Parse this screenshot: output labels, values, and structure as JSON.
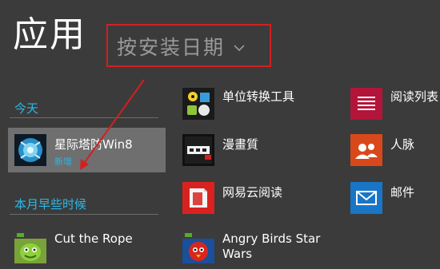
{
  "header": {
    "title": "应用",
    "sort_label": "按安装日期"
  },
  "sections": {
    "today": "今天",
    "earlier": "本月早些时候"
  },
  "apps": {
    "xingji": {
      "name": "星际塔防Win8",
      "badge": "新增"
    },
    "cut_the_rope": {
      "name": "Cut the Rope"
    },
    "danwei": {
      "name": "单位转换工具"
    },
    "manhua": {
      "name": "漫畫質"
    },
    "wangyi": {
      "name": "网易云阅读"
    },
    "angry_birds": {
      "name_line1": "Angry Birds Star",
      "name_line2": "Wars"
    },
    "yuedu": {
      "name": "阅读列表"
    },
    "renmai": {
      "name": "人脉"
    },
    "youjian": {
      "name": "邮件"
    }
  },
  "colors": {
    "background": "#3b3b3b",
    "accent_section": "#2bb8e6",
    "highlight_border": "#d41f1f",
    "selected_tile_bg": "#6f6f6f",
    "yuedu_tile": "#b3153a",
    "renmai_tile": "#d9481a",
    "youjian_tile": "#1976c7"
  },
  "icons": {
    "chevron": "chevron-down-icon",
    "arrow": "annotation-arrow"
  }
}
